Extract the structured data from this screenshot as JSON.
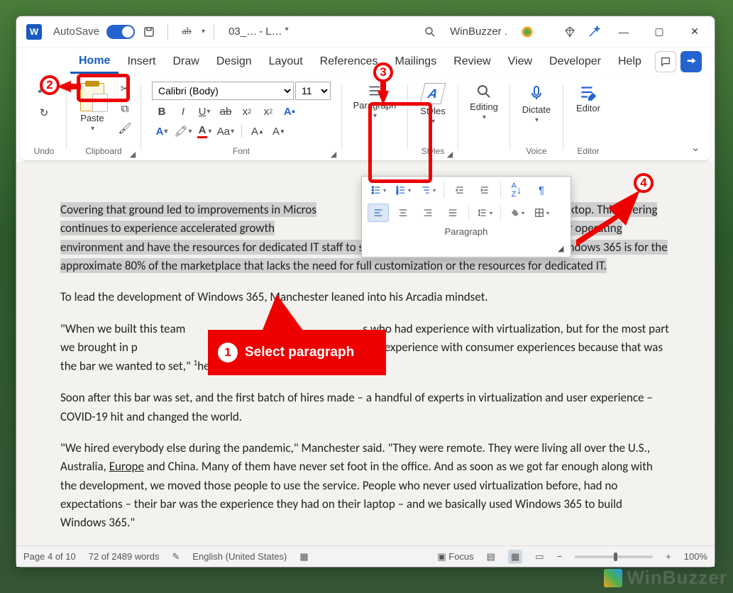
{
  "title": {
    "autosave": "AutoSave",
    "docname": "03_…",
    "docsuffix": "- L…",
    "user": "WinBuzzer ."
  },
  "tabs": [
    "Home",
    "Insert",
    "Draw",
    "Design",
    "Layout",
    "References",
    "Mailings",
    "Review",
    "View",
    "Developer",
    "Help"
  ],
  "active_tab": 0,
  "ribbon": {
    "undo": "Undo",
    "clipboard": {
      "label": "Clipboard",
      "paste": "Paste"
    },
    "font": {
      "label": "Font",
      "family": "Calibri (Body)",
      "size": "11"
    },
    "paragraph": "Paragraph",
    "styles": {
      "label": "Styles",
      "btn": "Styles"
    },
    "editing": "Editing",
    "voice": {
      "label": "Voice",
      "btn": "Dictate"
    },
    "editor": {
      "label": "Editor",
      "btn": "Editor"
    }
  },
  "popup": {
    "label": "Paragraph"
  },
  "document": {
    "p1a": "Covering that ground led to improvements in Micros",
    "p1b": "tual Desktop. This offering continues to experience accelerated growth",
    "p1c": "ation and control over their operating environment and have the resources ",
    "p1d": "for dedicated IT staff to support the system, Manchester noted. Windows 365 is for the approximate 80% of the marketplace that lacks the need for full customization or the resources for dedicated IT.",
    "p2": "To lead the development of Windows 365, Manchester leaned into his Arcadia mindset.",
    "p3a": "\"When we built this team",
    "p3b": "s who had experience with virtualization, but for the most part we brought in p",
    "p3c": "Windows and experience with consumer experiences because that was the bar we wanted to set,\" ",
    "p3d": "he said.",
    "p4": "Soon after this bar was set, and the first batch of hires made – a handful of experts in virtualization and user experience – COVID-19 hit and changed the world.",
    "p5a": "\"We hired everybody else during the pandemic,\" Manchester said. \"They were remote. They were living all over the U.S., Australia, ",
    "p5eu": "Europe",
    "p5b": " and China. Many of them have never set foot in the office. And as soon as we got far enough along with the development, we moved those people to use the service. People who never used virtualization before, had no expectations – their bar was the experience they had on their laptop – and we basically used Windows 365 to build Windows 365.\""
  },
  "status": {
    "page": "Page 4 of 10",
    "words": "72 of 2489 words",
    "lang": "English (United States)",
    "focus": "Focus",
    "zoom": "100%"
  },
  "annotations": {
    "c1": "1",
    "c1_text": "Select paragraph",
    "c2": "2",
    "c3": "3",
    "c4": "4"
  },
  "watermark": "WinBuzzer"
}
